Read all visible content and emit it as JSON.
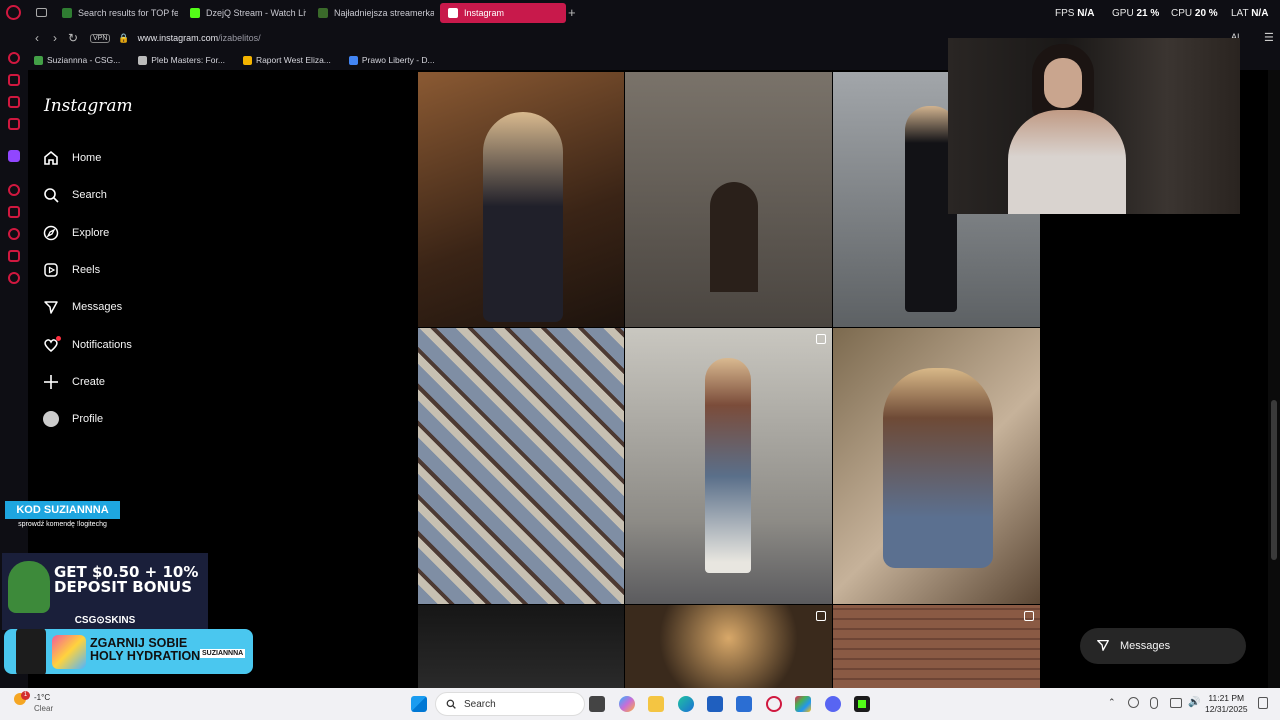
{
  "browser": {
    "tabs": [
      {
        "label": "Search results for TOP fe",
        "color": "#2f7d32"
      },
      {
        "label": "DzejQ Stream - Watch Liv",
        "color": "#53fc18"
      },
      {
        "label": "Najładniejsza streamerka",
        "color": "#3a6a2a"
      },
      {
        "label": "Instagram",
        "color": "#e1306c",
        "active": true
      }
    ],
    "new_tab": "+",
    "hud": {
      "fps_label": "FPS",
      "fps_value": "N/A",
      "gpu_label": "GPU",
      "gpu_value": "21 %",
      "cpu_label": "CPU",
      "cpu_value": "20 %",
      "lat_label": "LAT",
      "lat_value": "N/A"
    },
    "vpn": "VPN",
    "url_host": "www.instagram.com",
    "url_path": "/izabelitos/",
    "ai_label": "AI",
    "bookmarks": [
      {
        "label": "Suziannna - CSG...",
        "color": "#43a047"
      },
      {
        "label": "Pleb Masters: For...",
        "color": "#bbbbbb"
      },
      {
        "label": "Raport West Eliza...",
        "color": "#f4b400"
      },
      {
        "label": "Prawo Liberty - D...",
        "color": "#4285f4"
      }
    ]
  },
  "instagram": {
    "logo": "Instagram",
    "nav": [
      {
        "label": "Home",
        "icon": "home-icon"
      },
      {
        "label": "Search",
        "icon": "search-icon"
      },
      {
        "label": "Explore",
        "icon": "compass-icon"
      },
      {
        "label": "Reels",
        "icon": "reels-icon"
      },
      {
        "label": "Messages",
        "icon": "messenger-icon"
      },
      {
        "label": "Notifications",
        "icon": "heart-icon"
      },
      {
        "label": "Create",
        "icon": "plus-icon"
      },
      {
        "label": "Profile",
        "icon": "avatar-icon"
      }
    ],
    "posts": [
      {
        "desc": "blonde woman with chihuahua and drink",
        "colors": [
          "#6b4a2f",
          "#2a1b12"
        ]
      },
      {
        "desc": "old stone building facade with entrance",
        "colors": [
          "#6e665d",
          "#3d3833"
        ]
      },
      {
        "desc": "woman in black outfit on street",
        "colors": [
          "#8b8f92",
          "#4f5356"
        ]
      },
      {
        "desc": "close-up plaid shirt and sneakers",
        "colors": [
          "#7b8aa0",
          "#c9c2b6"
        ]
      },
      {
        "desc": "woman in plaid shirt by wall",
        "colors": [
          "#b9b7b0",
          "#5a5a5c"
        ],
        "multi": true
      },
      {
        "desc": "woman in plaid shirt in cafe",
        "colors": [
          "#a08a6a",
          "#4b3a2b"
        ]
      },
      {
        "desc": "dark photo row 3",
        "colors": [
          "#1a1a1a",
          "#3a3a3a"
        ]
      },
      {
        "desc": "woman under cafe lights",
        "colors": [
          "#3a2a1c",
          "#c89a5a"
        ],
        "multi": true
      },
      {
        "desc": "woman by brick wall",
        "colors": [
          "#8a5a44",
          "#4a2e22"
        ],
        "multi": true
      }
    ],
    "messages_pill": "Messages"
  },
  "overlays": {
    "kod_title": "KOD SUZIANNNA",
    "kod_sub": "sprowdź komendę !logitechg",
    "promo_line1": "GET $0.50 + 10%",
    "promo_line2": "DEPOSIT BONUS",
    "promo_brand": "CSG⊙SKINS",
    "hydra_line1": "ZGARNIJ SOBIE",
    "hydra_line2": "HOLY HYDRATION",
    "hydra_brand": "SUZIANNNA"
  },
  "taskbar": {
    "weather_temp": "-1°C",
    "weather_desc": "Clear",
    "search_placeholder": "Search",
    "time": "11:21 PM",
    "date": "12/31/2025"
  }
}
